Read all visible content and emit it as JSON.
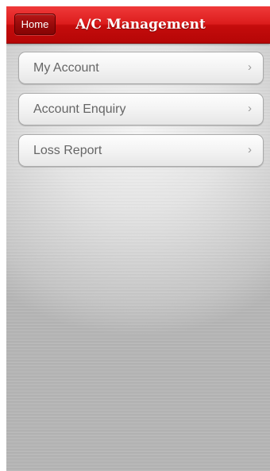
{
  "header": {
    "home_label": "Home",
    "title": "A/C Management"
  },
  "menu": {
    "items": [
      {
        "label": "My Account",
        "chevron": "›"
      },
      {
        "label": "Account Enquiry",
        "chevron": "›"
      },
      {
        "label": "Loss Report",
        "chevron": "›"
      }
    ]
  },
  "colors": {
    "header_red": "#dc1c1c",
    "home_button_red": "#9a0b0b",
    "label_gray": "#666666",
    "background_silver": "#d6d6d6"
  },
  "icons": [
    "chevron-right-icon"
  ]
}
